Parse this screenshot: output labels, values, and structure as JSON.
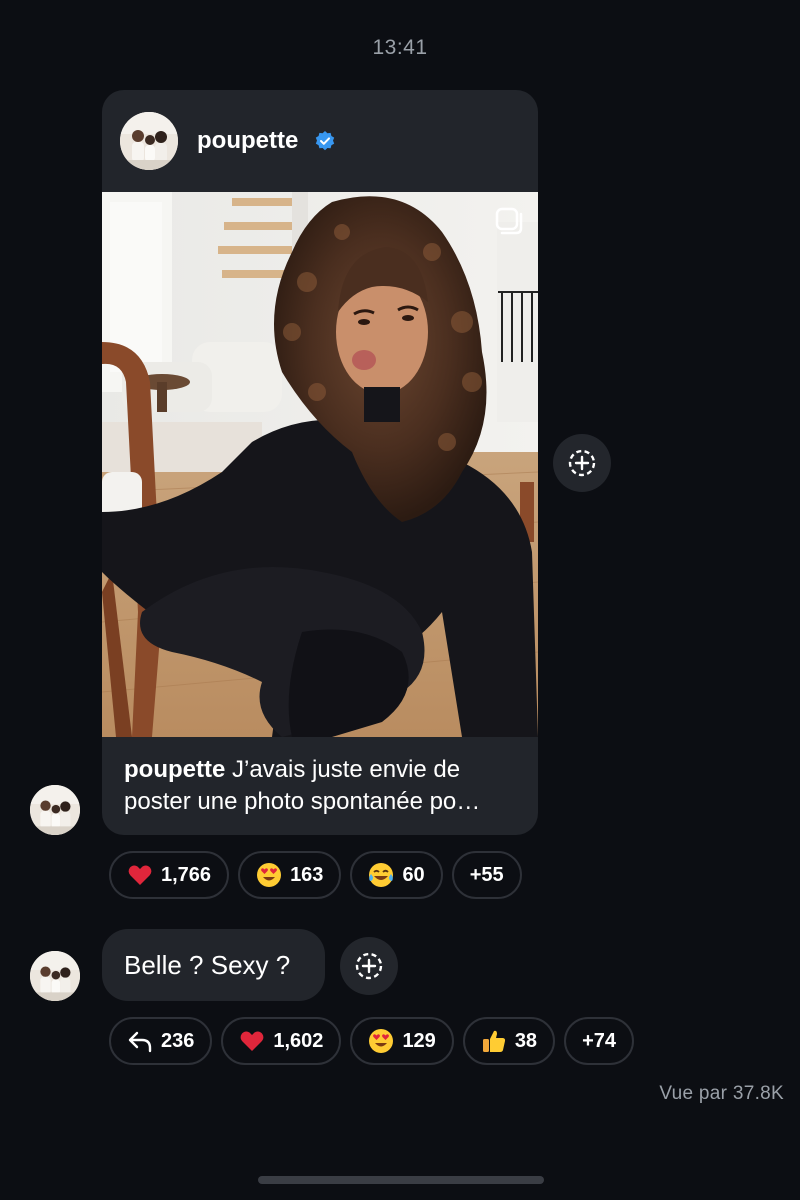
{
  "status": {
    "time": "13:41"
  },
  "post": {
    "username": "poupette",
    "verified": true,
    "caption_user": "poupette",
    "caption_text": " J’avais juste envie de poster une photo spontanée po…",
    "reactions": [
      {
        "emoji": "red-heart",
        "count": "1,766"
      },
      {
        "emoji": "heart-eyes",
        "count": "163"
      },
      {
        "emoji": "tears-of-joy",
        "count": "60"
      },
      {
        "emoji": "",
        "count": "+55"
      }
    ]
  },
  "message": {
    "text": "Belle ? Sexy ?",
    "reactions": [
      {
        "emoji": "reply-arrow",
        "count": "236"
      },
      {
        "emoji": "red-heart",
        "count": "1,602"
      },
      {
        "emoji": "heart-eyes",
        "count": "129"
      },
      {
        "emoji": "thumbs-up",
        "count": "38"
      },
      {
        "emoji": "",
        "count": "+74"
      }
    ]
  },
  "footer": {
    "seen_by": "Vue par 37.8K"
  },
  "colors": {
    "background": "#0c0e13",
    "bubble": "#22252b",
    "verified": "#3897f0",
    "muted_text": "#9aa0a8"
  }
}
